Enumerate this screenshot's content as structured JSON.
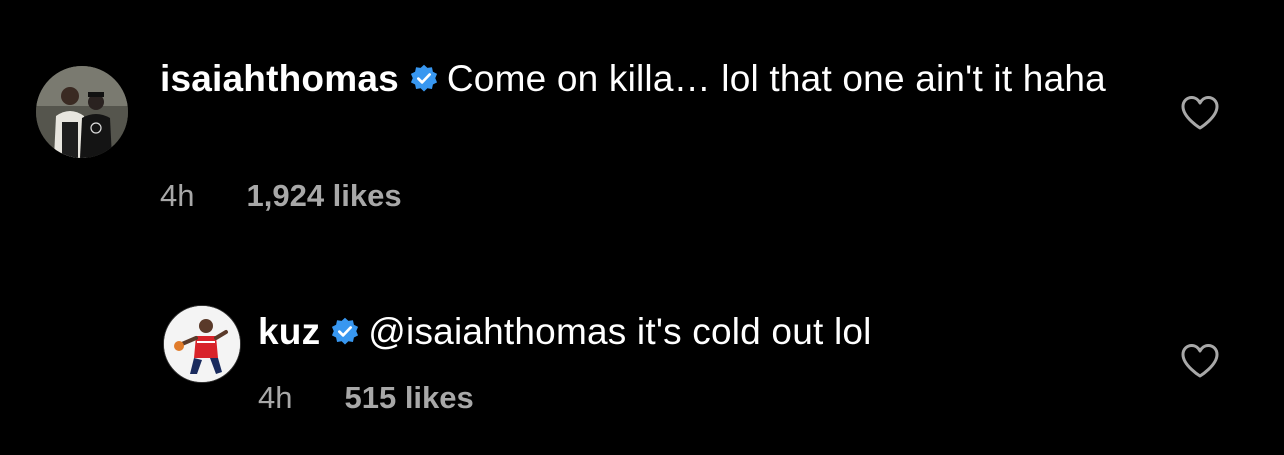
{
  "comments": [
    {
      "username": "isaiahthomas",
      "verified": true,
      "text": "Come on killa… lol that one ain't it haha",
      "time": "4h",
      "likes": "1,924 likes",
      "avatar_icon": "profile-photo-two-men",
      "liked": false
    },
    {
      "username": "kuz",
      "verified": true,
      "text": "@isaiahthomas it's cold out lol",
      "time": "4h",
      "likes": "515 likes",
      "avatar_icon": "profile-photo-basketball-player",
      "liked": false
    }
  ],
  "colors": {
    "background": "#000000",
    "text": "#ffffff",
    "meta": "#a8a8a8",
    "verified_badge": "#3897f0"
  }
}
